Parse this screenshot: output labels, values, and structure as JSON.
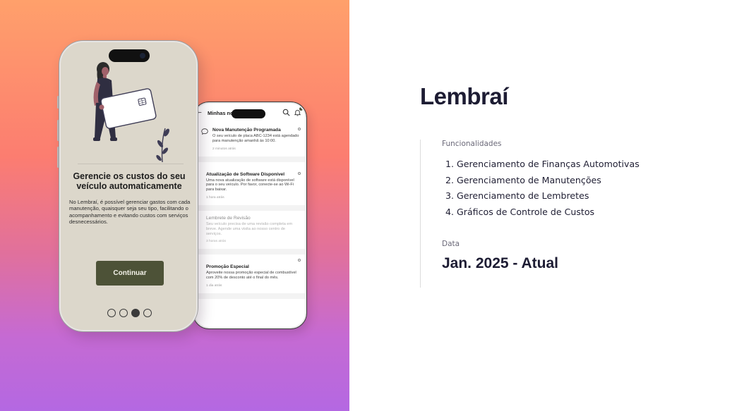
{
  "onboarding": {
    "title": "Gerencie os custos do seu veículo automaticamente",
    "body": "No Lembraí, é possível gerenciar gastos com cada manutenção, quaisquer seja seu tipo, facilitando o acompanhamento e evitando custos com serviços desnecessários.",
    "button_label": "Continuar",
    "page_total": 4,
    "page_current": 3
  },
  "notifications_screen": {
    "title": "Minhas notificações",
    "back_icon": "arrow-left-icon",
    "items": [
      {
        "title": "Nova Manutenção Programada",
        "body": "O seu veículo de placa ABC-1234 está agendado para manutenção amanhã às 10:00.",
        "time": "2 minutos atrás"
      },
      {
        "title": "Atualização de Software Disponível",
        "body": "Uma nova atualização de software está disponível para o seu veículo. Por favor, conecte-se ao Wi-Fi para baixar.",
        "time": "1 hora atrás"
      },
      {
        "title": "Lembrete de Revisão",
        "body": "Seu veículo precisa de uma revisão completa em breve. Agende uma visita ao nosso centro de serviços.",
        "time": "3 horas atrás"
      },
      {
        "title": "Promoção Especial",
        "body": "Aproveite nossa promoção especial de combustível com 20% de desconto até o final do mês.",
        "time": "1 dia atrás"
      }
    ]
  },
  "project": {
    "name": "Lembraí",
    "features_label": "Funcionalidades",
    "features": [
      "1. Gerenciamento de Finanças Automotivas",
      "2. Gerenciamento de Manutenções",
      "3. Gerenciamento de Lembretes",
      "4. Gráficos de Controle de Custos"
    ],
    "date_label": "Data",
    "date_value": "Jan. 2025 - Atual"
  },
  "colors": {
    "accent": "#4d5237",
    "onboarding_bg": "#dcd7cb",
    "text_dark": "#1d1c33"
  }
}
